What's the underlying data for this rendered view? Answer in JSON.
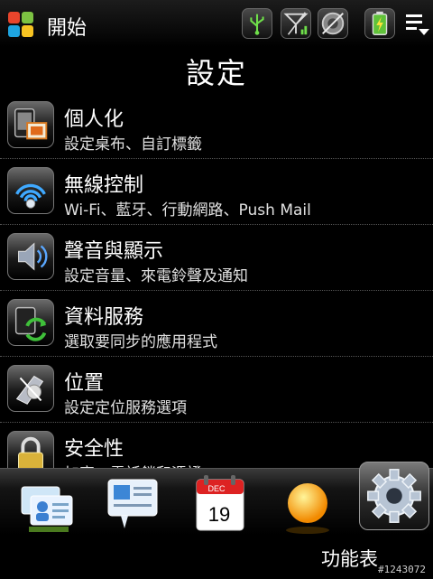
{
  "status_bar": {
    "start_label": "開始",
    "icons": [
      "usb-icon",
      "signal-icon",
      "speaker-icon",
      "battery-icon",
      "menu-icon"
    ]
  },
  "page": {
    "title": "設定"
  },
  "settings_items": [
    {
      "title": "個人化",
      "subtitle": "設定桌布、自訂標籤",
      "icon": "personalize-icon"
    },
    {
      "title": "無線控制",
      "subtitle": "Wi-Fi、藍牙、行動網路、Push Mail",
      "icon": "wireless-icon"
    },
    {
      "title": "聲音與顯示",
      "subtitle": "設定音量、來電鈴聲及通知",
      "icon": "sound-icon"
    },
    {
      "title": "資料服務",
      "subtitle": "選取要同步的應用程式",
      "icon": "data-sync-icon"
    },
    {
      "title": "位置",
      "subtitle": "設定定位服務選項",
      "icon": "location-icon"
    },
    {
      "title": "安全性",
      "subtitle": "加密、電話鎖和憑證",
      "icon": "lock-icon"
    }
  ],
  "dock": {
    "calendar_month": "DEC",
    "calendar_day": "19",
    "active_label": "功能表",
    "items": [
      "contacts-icon",
      "messages-icon",
      "calendar-icon",
      "weather-icon",
      "settings-icon"
    ]
  },
  "watermark": "#1243072"
}
